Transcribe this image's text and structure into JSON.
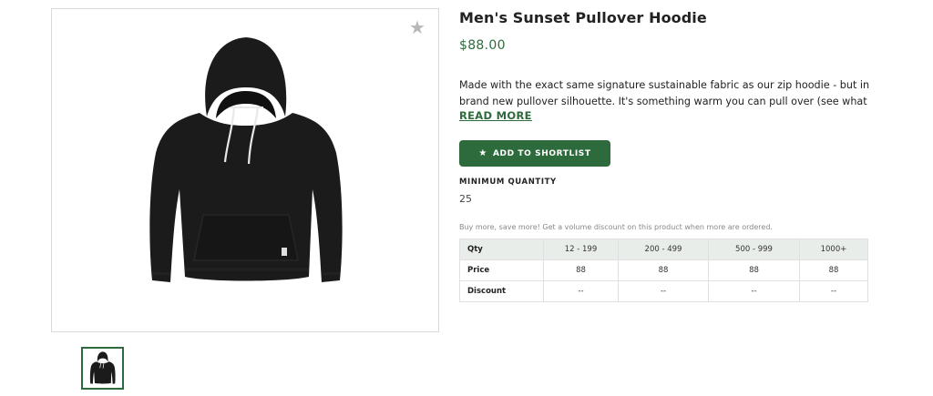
{
  "product": {
    "title": "Men's Sunset Pullover Hoodie",
    "price": "$88.00",
    "description_line1": "Made with the exact same signature sustainable fabric as our zip hoodie - but in a",
    "description_line2": "brand new pullover silhouette. It's something warm you can pull over (see what we ...",
    "read_more": "READ MORE"
  },
  "actions": {
    "add_to_shortlist": "ADD TO SHORTLIST",
    "star_icon": "star-icon"
  },
  "minimum_quantity": {
    "label": "MINIMUM QUANTITY",
    "value": "25"
  },
  "volume": {
    "note": "Buy more, save more! Get a volume discount on this product when more are ordered.",
    "headers": [
      "Qty",
      "12 - 199",
      "200 - 499",
      "500 - 999",
      "1000+"
    ],
    "rows": [
      {
        "label": "Price",
        "values": [
          "88",
          "88",
          "88",
          "88"
        ]
      },
      {
        "label": "Discount",
        "values": [
          "--",
          "--",
          "--",
          "--"
        ]
      }
    ]
  },
  "colors": {
    "accent_green": "#2e6b3c",
    "table_header_bg": "#e9edea",
    "hoodie": "#1b1b1b"
  }
}
